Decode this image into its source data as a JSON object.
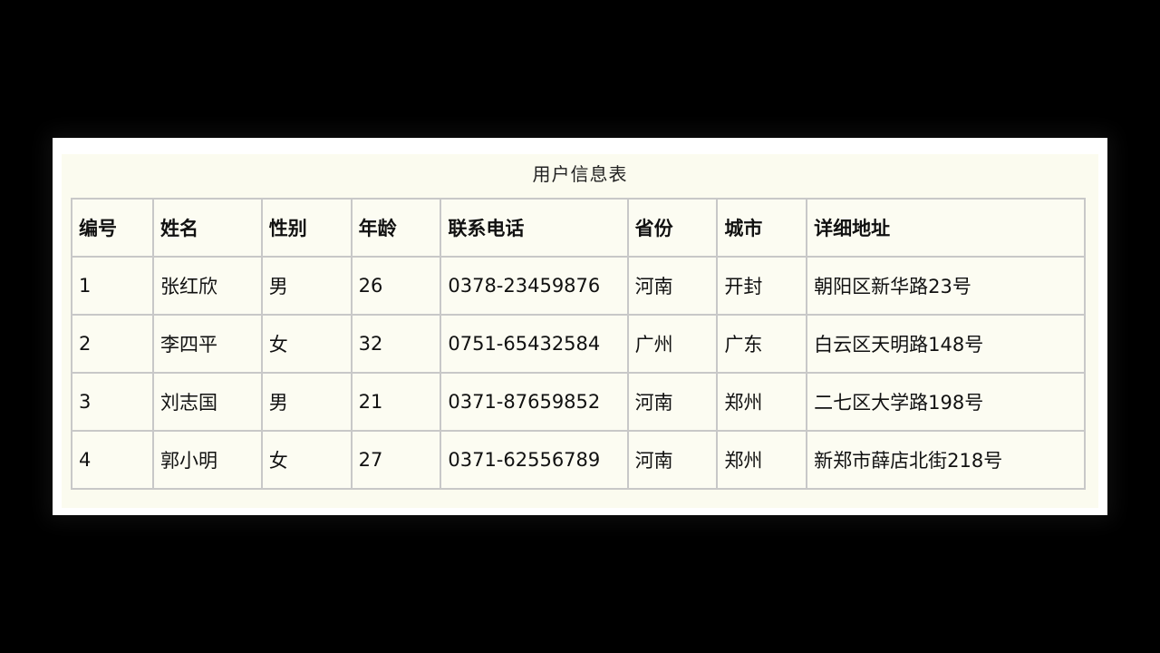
{
  "table": {
    "caption": "用户信息表",
    "headers": [
      "编号",
      "姓名",
      "性别",
      "年龄",
      "联系电话",
      "省份",
      "城市",
      "详细地址"
    ],
    "rows": [
      [
        "1",
        "张红欣",
        "男",
        "26",
        "0378-23459876",
        "河南",
        "开封",
        "朝阳区新华路23号"
      ],
      [
        "2",
        "李四平",
        "女",
        "32",
        "0751-65432584",
        "广州",
        "广东",
        "白云区天明路148号"
      ],
      [
        "3",
        "刘志国",
        "男",
        "21",
        "0371-87659852",
        "河南",
        "郑州",
        "二七区大学路198号"
      ],
      [
        "4",
        "郭小明",
        "女",
        "27",
        "0371-62556789",
        "河南",
        "郑州",
        "新郑市薛店北街218号"
      ]
    ]
  }
}
